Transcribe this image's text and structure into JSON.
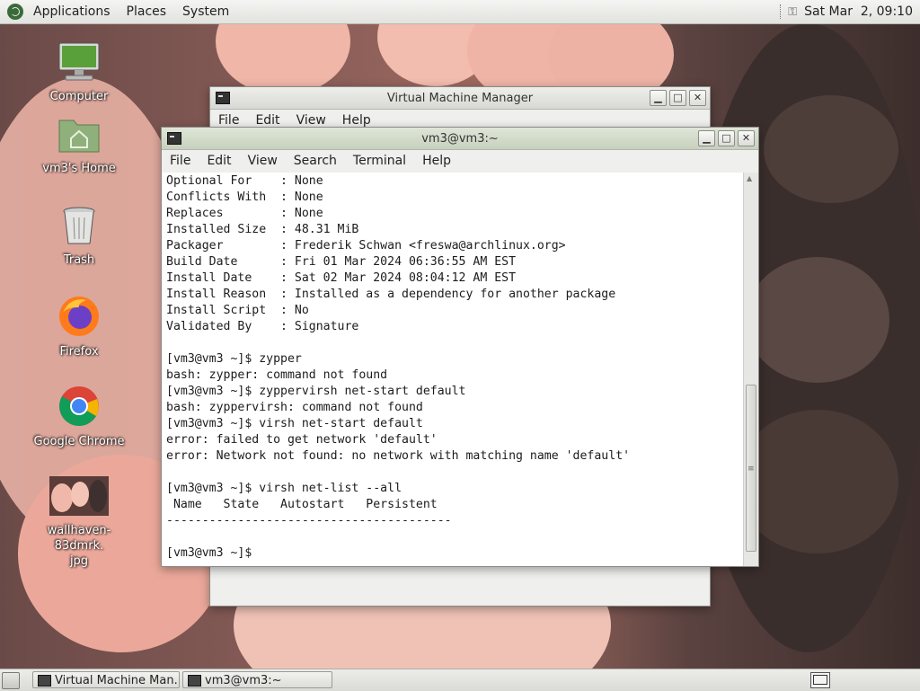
{
  "top_panel": {
    "menus": [
      "Applications",
      "Places",
      "System"
    ],
    "clock": "Sat Mar  2, 09:10"
  },
  "desktop": {
    "icons": [
      {
        "label": "Computer"
      },
      {
        "label": "vm3's Home"
      },
      {
        "label": "Trash"
      },
      {
        "label": "Firefox"
      },
      {
        "label": "Google Chrome"
      },
      {
        "label": "wallhaven-83dmrk.\njpg"
      }
    ]
  },
  "vmm_window": {
    "title": "Virtual Machine Manager",
    "menu": [
      "File",
      "Edit",
      "View",
      "Help"
    ]
  },
  "terminal_window": {
    "title": "vm3@vm3:~",
    "menu": [
      "File",
      "Edit",
      "View",
      "Search",
      "Terminal",
      "Help"
    ],
    "lines": [
      "Optional For    : None",
      "Conflicts With  : None",
      "Replaces        : None",
      "Installed Size  : 48.31 MiB",
      "Packager        : Frederik Schwan <freswa@archlinux.org>",
      "Build Date      : Fri 01 Mar 2024 06:36:55 AM EST",
      "Install Date    : Sat 02 Mar 2024 08:04:12 AM EST",
      "Install Reason  : Installed as a dependency for another package",
      "Install Script  : No",
      "Validated By    : Signature",
      "",
      "[vm3@vm3 ~]$ zypper",
      "bash: zypper: command not found",
      "[vm3@vm3 ~]$ zyppervirsh net-start default",
      "bash: zyppervirsh: command not found",
      "[vm3@vm3 ~]$ virsh net-start default",
      "error: failed to get network 'default'",
      "error: Network not found: no network with matching name 'default'",
      "",
      "[vm3@vm3 ~]$ virsh net-list --all",
      " Name   State   Autostart   Persistent",
      "----------------------------------------",
      "",
      "[vm3@vm3 ~]$ "
    ]
  },
  "taskbar": {
    "tasks": [
      {
        "label": "Virtual Machine Man..."
      },
      {
        "label": "vm3@vm3:~"
      }
    ]
  }
}
